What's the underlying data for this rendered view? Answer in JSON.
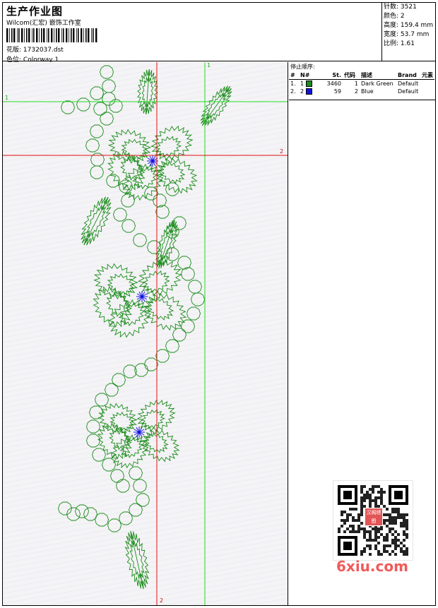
{
  "header": {
    "title": "生产作业图",
    "subtitle": "Wilcom(汇宏) 嵌饰工作室",
    "design_file_label": "花版:",
    "design_file": "1732037.dst",
    "colorway_label": "色位:",
    "colorway": "Colorway 1"
  },
  "stats": {
    "stitches_label": "针数:",
    "stitches": "3521",
    "colors_label": "颜色:",
    "colors": "2",
    "height_label": "高度:",
    "height": "159.4 mm",
    "width_label": "宽度:",
    "width": "53.7 mm",
    "scale_label": "比例:",
    "scale": "1.61"
  },
  "stop_sequence": {
    "title": "停止顺序:",
    "headers": [
      "#",
      "N#",
      "St.",
      "代码",
      "描述",
      "Brand",
      "元素"
    ],
    "rows": [
      {
        "idx": "1.",
        "n": "1",
        "color": "#1a8c1a",
        "stitches": "3460",
        "code": "1",
        "desc": "Dark Green",
        "brand": "Default",
        "element": ""
      },
      {
        "idx": "2.",
        "n": "2",
        "color": "#1010e0",
        "stitches": "59",
        "code": "2",
        "desc": "Blue",
        "brand": "Default",
        "element": ""
      }
    ]
  },
  "guides": {
    "green_v": "1",
    "green_h": "1",
    "red_h": "2",
    "red_v": "2"
  },
  "colors": {
    "thread_green": "#1a8c1a",
    "thread_blue": "#1010e0",
    "guide_green": "#22dd22",
    "guide_red": "#e01010",
    "watermark": "#f05a5a"
  },
  "watermark": {
    "text": "6xiu.com",
    "badge": "汉阁绣图"
  }
}
